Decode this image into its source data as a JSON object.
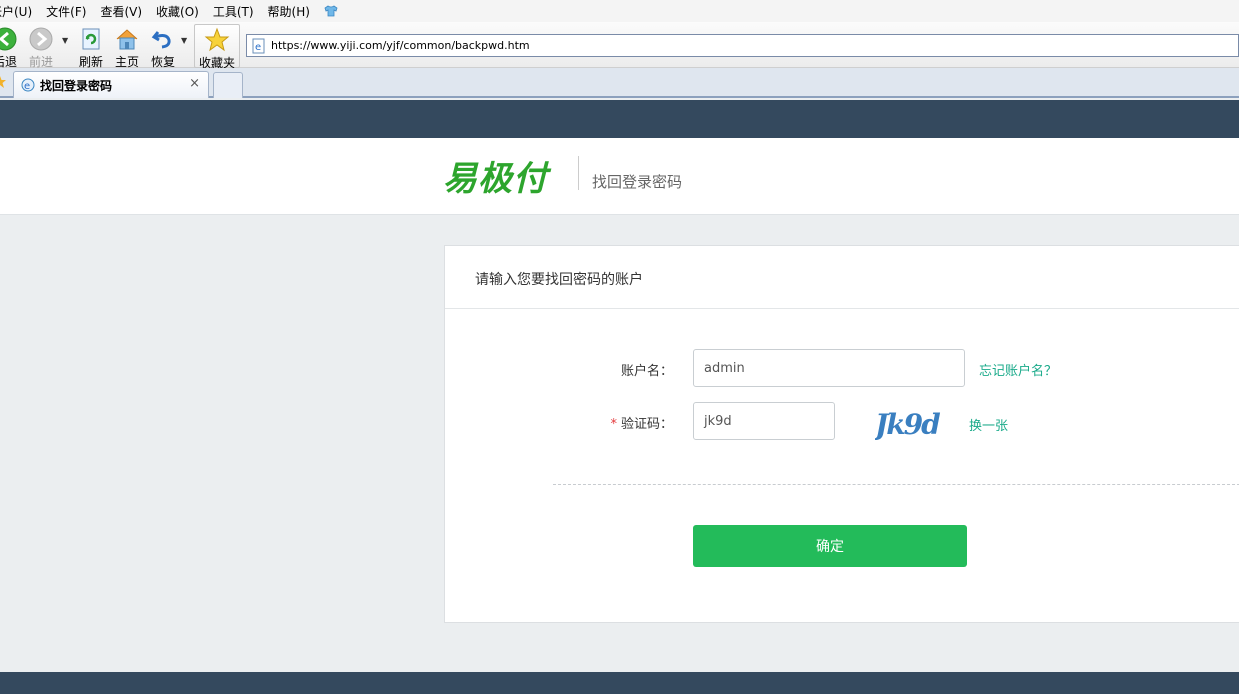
{
  "browser": {
    "menu": [
      "帐户(U)",
      "文件(F)",
      "查看(V)",
      "收藏(O)",
      "工具(T)",
      "帮助(H)"
    ],
    "toolbar": {
      "back": "后退",
      "forward": "前进",
      "refresh": "刷新",
      "home": "主页",
      "restore": "恢复",
      "favorites": "收藏夹"
    },
    "address_url": "https://www.yiji.com/yjf/common/backpwd.htm",
    "tab_title": "找回登录密码",
    "tab_close": "×"
  },
  "site": {
    "logo": "易极付",
    "header_subtitle": "找回登录密码",
    "panel_title": "请输入您要找回密码的账户",
    "account_label": "账户名：",
    "account_value": "admin",
    "forgot_account_link": "忘记账户名？",
    "captcha_required_mark": "*",
    "captcha_label": "验证码：",
    "captcha_value": "jk9d",
    "captcha_image_text": "Jk9d",
    "refresh_captcha_link": "换一张",
    "submit_label": "确定"
  },
  "colors": {
    "brand_green": "#2da52d",
    "button_green": "#23bb5a",
    "link_teal": "#1aaa8a",
    "topbar": "#34495e"
  }
}
